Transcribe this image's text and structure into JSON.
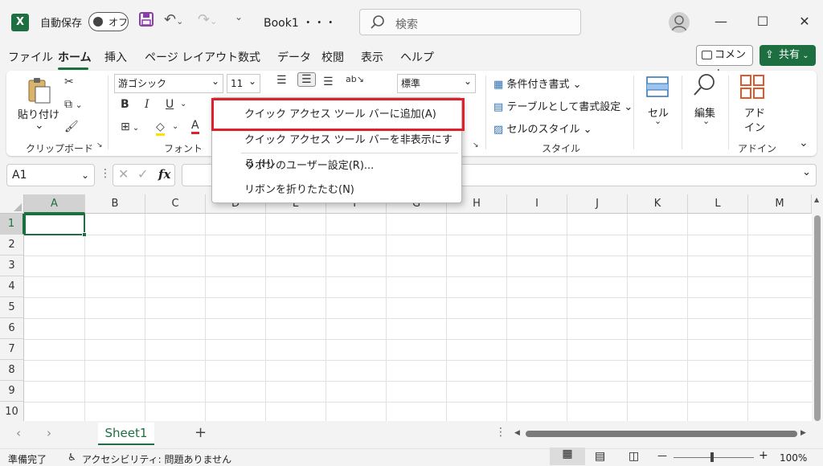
{
  "titlebar": {
    "app_icon": "X",
    "autosave_label": "自動保存",
    "autosave_state": "オフ",
    "book_title": "Book1 ・・・",
    "search_placeholder": "検索",
    "window_controls": [
      "—",
      "☐",
      "✕"
    ]
  },
  "tabs": [
    "ファイル",
    "ホーム",
    "挿入",
    "ページ レイアウト",
    "数式",
    "データ",
    "校閲",
    "表示",
    "ヘルプ"
  ],
  "active_tab": "ホーム",
  "comment_label": "コメント",
  "share_label": "共有",
  "ribbon": {
    "clipboard": {
      "paste_label": "貼り付け",
      "group_label": "クリップボード"
    },
    "font": {
      "font_name": "游ゴシック",
      "font_size": "11",
      "group_label": "フォント",
      "bold": "B",
      "italic": "I",
      "underline": "U",
      "font_color": "A"
    },
    "number": {
      "format": "標準"
    },
    "styles": {
      "conditional": "条件付き書式",
      "table_format": "テーブルとして書式設定",
      "cell_style": "セルのスタイル",
      "group_label": "スタイル"
    },
    "cells_label": "セル",
    "editing_label": "編集",
    "addin_label_1": "アド",
    "addin_label_2": "イン",
    "addin_group_label": "アドイン"
  },
  "formula_bar": {
    "name_box": "A1",
    "fx": "fx"
  },
  "columns": [
    "A",
    "B",
    "C",
    "D",
    "E",
    "F",
    "G",
    "H",
    "I",
    "J",
    "K",
    "L",
    "M"
  ],
  "rows": [
    "1",
    "2",
    "3",
    "4",
    "5",
    "6",
    "7",
    "8",
    "9",
    "10"
  ],
  "sheet": {
    "tab_name": "Sheet1",
    "add": "+"
  },
  "status": {
    "ready": "準備完了",
    "accessibility": "アクセシビリティ: 問題ありません",
    "zoom": "100%"
  },
  "context_menu": {
    "items": [
      "クイック アクセス ツール バーに追加(A)",
      "クイック アクセス ツール バーを非表示にする (H)",
      "リボンのユーザー設定(R)...",
      "リボンを折りたたむ(N)"
    ]
  },
  "colors": {
    "accent": "#1d6f42",
    "highlight_box": "#e0202a"
  }
}
